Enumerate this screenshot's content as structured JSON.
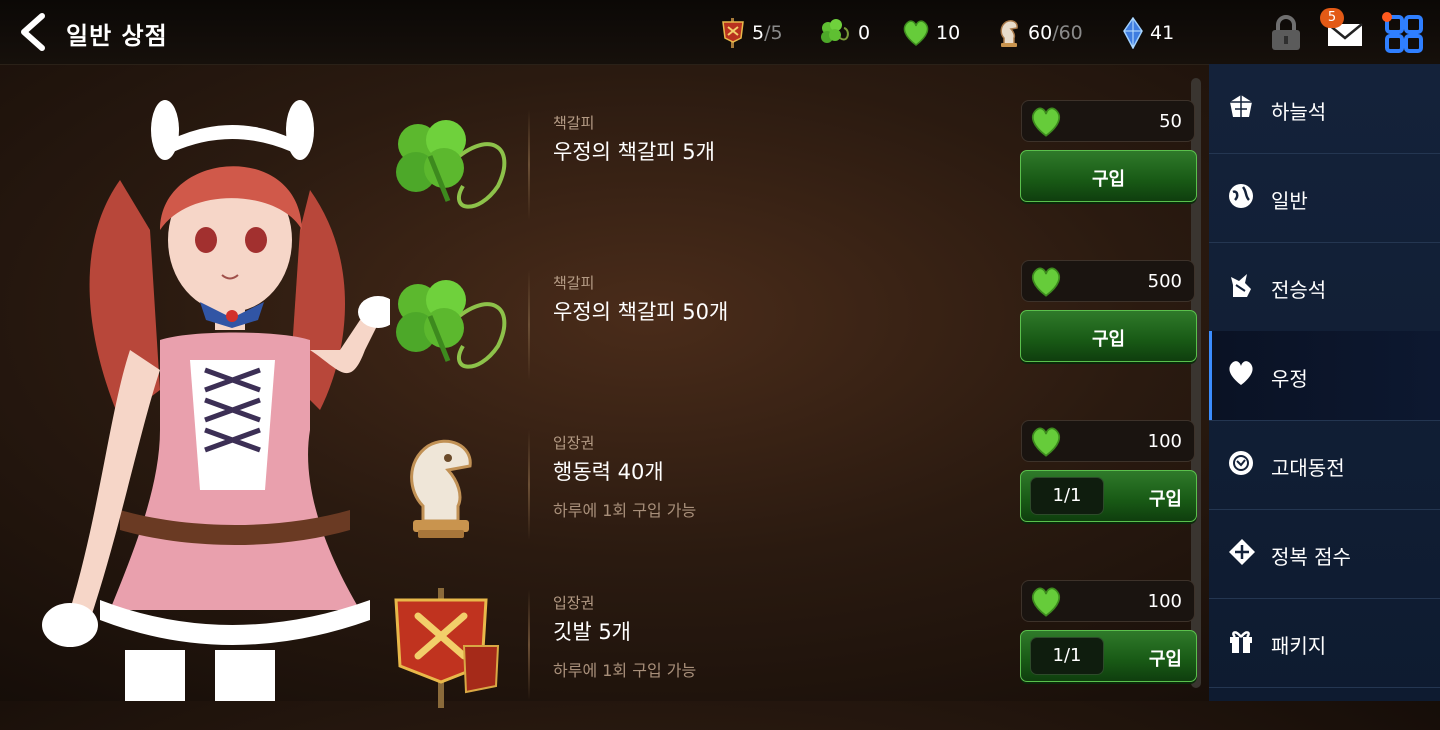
{
  "header": {
    "title": "일반 상점",
    "resources": [
      {
        "icon": "flag-icon",
        "value": "5",
        "max": "/5"
      },
      {
        "icon": "clover-icon",
        "value": "0",
        "max": ""
      },
      {
        "icon": "heart-icon",
        "value": "10",
        "max": ""
      },
      {
        "icon": "knight-icon",
        "value": "60",
        "max": "/60"
      },
      {
        "icon": "crystal-icon",
        "value": "41",
        "max": ""
      }
    ],
    "mail_badge": "5"
  },
  "items": [
    {
      "category": "책갈피",
      "name": "우정의 책갈피 5개",
      "note": "",
      "price": "50",
      "buy_label": "구입",
      "limit": ""
    },
    {
      "category": "책갈피",
      "name": "우정의 책갈피 50개",
      "note": "",
      "price": "500",
      "buy_label": "구입",
      "limit": ""
    },
    {
      "category": "입장권",
      "name": "행동력 40개",
      "note": "하루에 1회 구입 가능",
      "price": "100",
      "buy_label": "구입",
      "limit": "1/1"
    },
    {
      "category": "입장권",
      "name": "깃발 5개",
      "note": "하루에 1회 구입 가능",
      "price": "100",
      "buy_label": "구입",
      "limit": "1/1"
    }
  ],
  "menu": [
    {
      "label": "하늘석",
      "icon": "sky-stone-icon",
      "active": false
    },
    {
      "label": "일반",
      "icon": "globe-icon",
      "active": false
    },
    {
      "label": "전승석",
      "icon": "legend-stone-icon",
      "active": false
    },
    {
      "label": "우정",
      "icon": "heart-icon",
      "active": true
    },
    {
      "label": "고대동전",
      "icon": "ancient-coin-icon",
      "active": false
    },
    {
      "label": "정복 점수",
      "icon": "conquest-icon",
      "active": false
    },
    {
      "label": "패키지",
      "icon": "gift-icon",
      "active": false
    }
  ],
  "colors": {
    "accent": "#3b8dff",
    "buy_green": "#2f7a2a",
    "badge": "#e35a16",
    "menu_bg": "#14223a"
  }
}
